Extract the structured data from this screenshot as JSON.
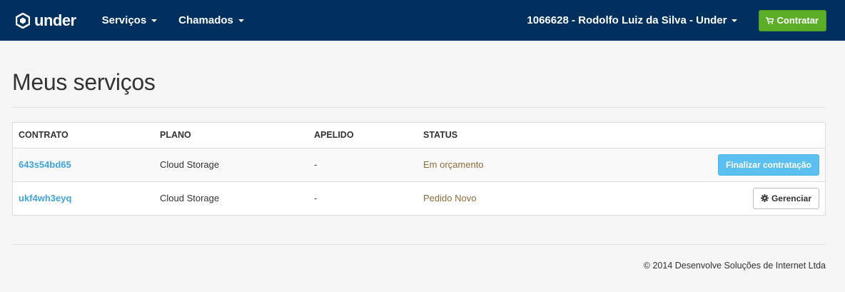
{
  "navbar": {
    "brand": {
      "text": "under",
      "icon": "under-logo-icon"
    },
    "menu": [
      {
        "label": "Serviços"
      },
      {
        "label": "Chamados"
      }
    ],
    "user_label": "1066628 - Rodolfo Luiz da Silva - Under",
    "cta_label": "Contratar",
    "cta_icon": "cart-icon",
    "colors": {
      "background": "#00305f",
      "cta": "#5cae29"
    }
  },
  "page": {
    "title": "Meus serviços"
  },
  "table": {
    "headers": {
      "contrato": "CONTRATO",
      "plano": "PLANO",
      "apelido": "APELIDO",
      "status": "STATUS"
    },
    "rows": [
      {
        "contrato": "643s54bd65",
        "plano": "Cloud Storage",
        "apelido": "-",
        "status": "Em orçamento",
        "action": "Finalizar contratação"
      },
      {
        "contrato": "ukf4wh3eyq",
        "plano": "Cloud Storage",
        "apelido": "-",
        "status": "Pedido Novo",
        "action": "Gerenciar",
        "action_icon": "gear-icon"
      }
    ],
    "colors": {
      "link": "#3fa3dc",
      "status": "#8a6d3b",
      "primary_action": "#5bc0f0"
    }
  },
  "footer": {
    "text": "© 2014 Desenvolve Soluções de Internet Ltda"
  }
}
